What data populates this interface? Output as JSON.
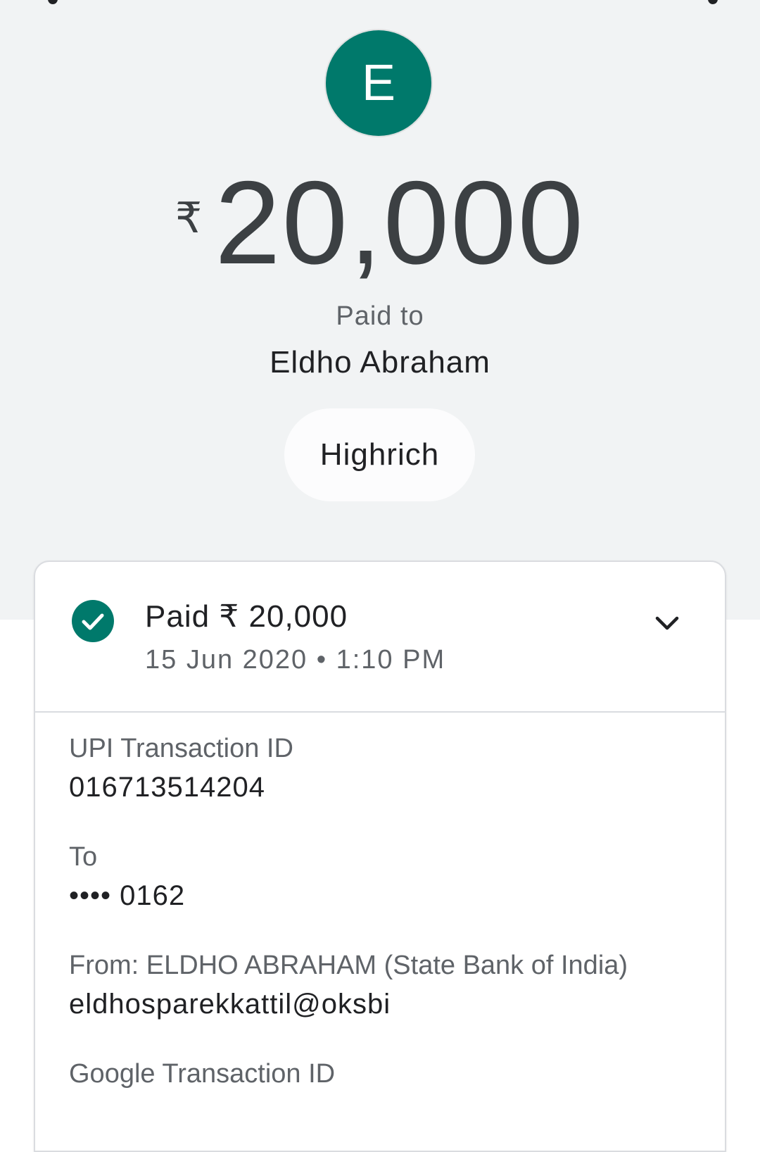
{
  "header": {
    "avatar_initial": "E",
    "currency_symbol": "₹",
    "amount": "20,000",
    "paid_to_label": "Paid to",
    "payee_name": "Eldho Abraham",
    "note": "Highrich"
  },
  "status_card": {
    "status_text": "Paid ₹ 20,000",
    "datetime": "15 Jun 2020 • 1:10 PM",
    "status_icon": "check-circle-icon",
    "expand_icon": "chevron-down-icon"
  },
  "details": {
    "upi_label": "UPI Transaction ID",
    "upi_value": "016713514204",
    "to_label": "To",
    "to_value": "•••• 0162",
    "from_label": "From: ELDHO  ABRAHAM (State Bank of India)",
    "from_value": "eldhosparekkattil@oksbi",
    "google_label": "Google Transaction ID"
  },
  "colors": {
    "accent": "#00796b",
    "background_top": "#f1f3f4",
    "text_primary": "#202124",
    "text_secondary": "#5f6368"
  }
}
